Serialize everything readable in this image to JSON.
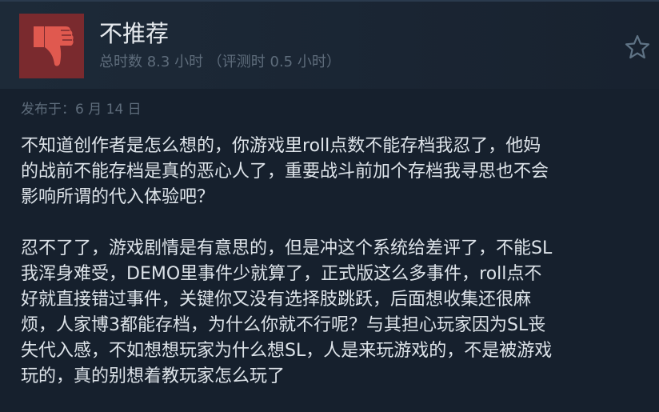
{
  "review": {
    "verdict": "不推荐",
    "playtime": "总时数 8.3 小时 （评测时 0.5 小时）",
    "posted": "发布于：6 月 14 日",
    "paragraphs": [
      "不知道创作者是怎么想的，你游戏里roll点数不能存档我忍了，他妈\n的战前不能存档是真的恶心人了，重要战斗前加个存档我寻思也不会\n影响所谓的代入体验吧？",
      "忍不了了，游戏剧情是有意思的，但是冲这个系统给差评了，不能SL\n我浑身难受，DEMO里事件少就算了，正式版这么多事件，roll点不\n好就直接错过事件，关键你又没有选择肢跳跃，后面想收集还很麻\n烦，人家博3都能存档，为什么你就不行呢？与其担心玩家因为SL丧\n失代入感，不如想想玩家为什么想SL，人是来玩游戏的，不是被游戏\n玩的，真的别想着教玩家怎么玩了"
    ]
  },
  "icons": {
    "thumb": "thumbs-down-icon",
    "favorite": "star-icon"
  },
  "colors": {
    "thumb_bg": "#7a2a2e",
    "thumb_fg": "#e0594f",
    "background": "#16202d",
    "text": "#dde3e9",
    "muted": "#5e6c7b"
  }
}
